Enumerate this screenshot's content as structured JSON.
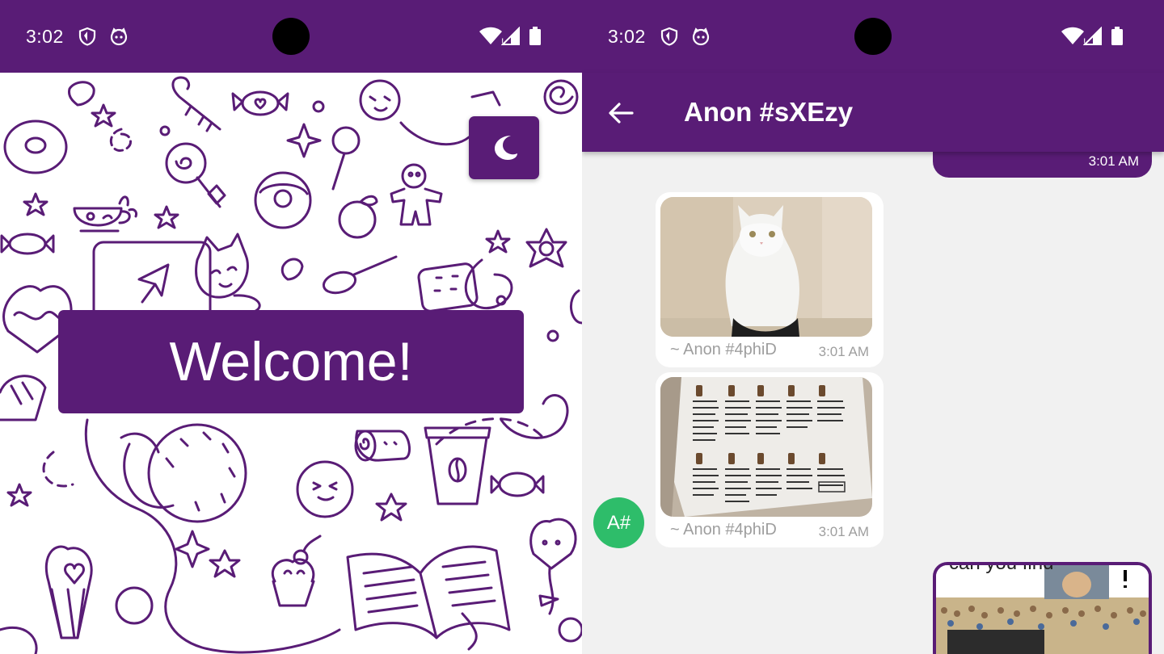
{
  "status_bar": {
    "time": "3:02"
  },
  "left_screen": {
    "welcome_text": "Welcome!",
    "theme_toggle_icon": "moon-icon"
  },
  "right_screen": {
    "chat_title": "Anon #sXEzy",
    "back_icon": "arrow-back-icon",
    "messages": [
      {
        "direction": "outgoing",
        "time": "3:01 AM"
      },
      {
        "direction": "incoming",
        "type": "image",
        "image": "white cat photo",
        "sender": "~ Anon #4phiD",
        "time": "3:01 AM"
      },
      {
        "direction": "incoming",
        "type": "image",
        "image": "boba tea menu photo",
        "sender": "~ Anon #4phiD",
        "time": "3:01 AM"
      },
      {
        "direction": "outgoing",
        "type": "image",
        "caption": "can you find"
      }
    ],
    "avatar_initials": "A#"
  },
  "colors": {
    "primary": "#591c76",
    "avatar": "#2ebd6a",
    "chat_bg": "#f1f1f1"
  }
}
